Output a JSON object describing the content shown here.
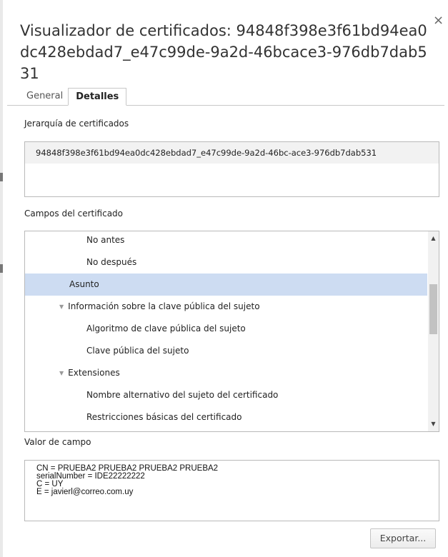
{
  "dialog": {
    "title": "Visualizador de certificados: 94848f398e3f61bd94ea0dc428ebdad7_e47c99de-9a2d-46bcace3-976db7dab531",
    "close_symbol": "×"
  },
  "tabs": [
    {
      "label": "General",
      "active": false
    },
    {
      "label": "Detalles",
      "active": true
    }
  ],
  "hierarchy": {
    "label": "Jerarquía de certificados",
    "items": [
      "94848f398e3f61bd94ea0dc428ebdad7_e47c99de-9a2d-46bc-ace3-976db7dab531"
    ]
  },
  "fields": {
    "label": "Campos del certificado",
    "rows": [
      {
        "label": "No antes",
        "level": 3,
        "expander": "",
        "selected": false
      },
      {
        "label": "No después",
        "level": 3,
        "expander": "",
        "selected": false
      },
      {
        "label": "Asunto",
        "level": 2,
        "expander": "",
        "selected": true
      },
      {
        "label": "Información sobre la clave pública del sujeto",
        "level": 2,
        "expander": "expanded",
        "selected": false
      },
      {
        "label": "Algoritmo de clave pública del sujeto",
        "level": 3,
        "expander": "",
        "selected": false
      },
      {
        "label": "Clave pública del sujeto",
        "level": 3,
        "expander": "",
        "selected": false
      },
      {
        "label": "Extensiones",
        "level": 2,
        "expander": "expanded",
        "selected": false
      },
      {
        "label": "Nombre alternativo del sujeto del certificado",
        "level": 3,
        "expander": "",
        "selected": false
      },
      {
        "label": "Restricciones básicas del certificado",
        "level": 3,
        "expander": "",
        "selected": false
      }
    ],
    "selected_color": "#cddcf2"
  },
  "field_value": {
    "label": "Valor de campo",
    "lines": [
      "CN = PRUEBA2 PRUEBA2 PRUEBA2 PRUEBA2",
      "serialNumber = IDE22222222",
      "C = UY",
      "E = javierl@correo.com.uy"
    ]
  },
  "buttons": {
    "export": "Exportar..."
  }
}
